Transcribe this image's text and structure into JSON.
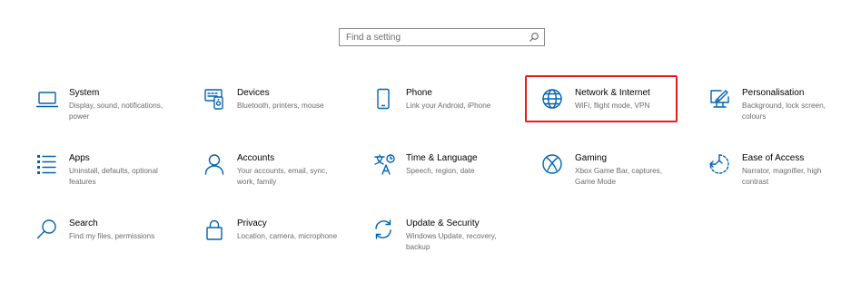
{
  "search": {
    "placeholder": "Find a setting"
  },
  "tiles": [
    {
      "title": "System",
      "desc": "Display, sound, notifications, power",
      "icon": "laptop-icon"
    },
    {
      "title": "Devices",
      "desc": "Bluetooth, printers, mouse",
      "icon": "devices-icon"
    },
    {
      "title": "Phone",
      "desc": "Link your Android, iPhone",
      "icon": "phone-icon"
    },
    {
      "title": "Network & Internet",
      "desc": "WiFi, flight mode, VPN",
      "icon": "globe-icon"
    },
    {
      "title": "Personalisation",
      "desc": "Background, lock screen, colours",
      "icon": "paint-monitor-icon"
    },
    {
      "title": "Apps",
      "desc": "Uninstall, defaults, optional features",
      "icon": "apps-list-icon"
    },
    {
      "title": "Accounts",
      "desc": "Your accounts, email, sync, work, family",
      "icon": "person-icon"
    },
    {
      "title": "Time & Language",
      "desc": "Speech, region, date",
      "icon": "time-language-icon"
    },
    {
      "title": "Gaming",
      "desc": "Xbox Game Bar, captures, Game Mode",
      "icon": "xbox-icon"
    },
    {
      "title": "Ease of Access",
      "desc": "Narrator, magnifier, high contrast",
      "icon": "ease-of-access-icon"
    },
    {
      "title": "Search",
      "desc": "Find my files, permissions",
      "icon": "search-icon"
    },
    {
      "title": "Privacy",
      "desc": "Location, camera, microphone",
      "icon": "lock-icon"
    },
    {
      "title": "Update & Security",
      "desc": "Windows Update, recovery, backup",
      "icon": "update-arrows-icon"
    }
  ],
  "colors": {
    "accent": "#0063b1",
    "highlight": "#e81b1b",
    "desc_text": "#6b6b6b"
  }
}
